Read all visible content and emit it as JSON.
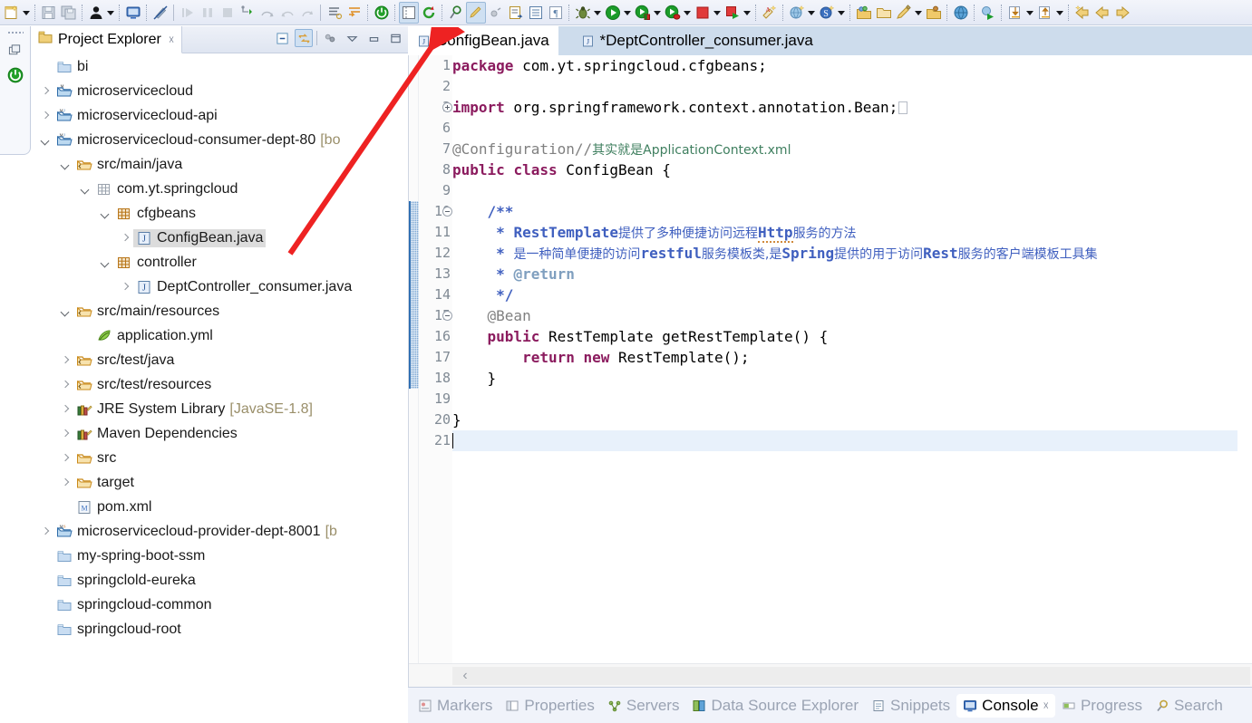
{
  "window": {
    "app": "Eclipse IDE"
  },
  "toolbar": {
    "items": [
      {
        "name": "new-wizard-icon",
        "label": "New"
      },
      {
        "name": "new-dropdown-arrow",
        "label": "New menu"
      },
      {
        "name": "save-icon",
        "label": "Save"
      },
      {
        "name": "save-all-icon",
        "label": "Save All"
      },
      {
        "name": "person-icon",
        "label": "Open Task"
      },
      {
        "name": "person-dropdown-arrow",
        "label": "Task menu"
      },
      {
        "name": "monitor-icon",
        "label": "Open Console"
      },
      {
        "name": "no-hover-icon",
        "label": "Disable hover"
      },
      {
        "name": "step-run-icon",
        "label": "Resume"
      },
      {
        "name": "pause-icon",
        "label": "Suspend"
      },
      {
        "name": "stop-icon",
        "label": "Terminate"
      },
      {
        "name": "step-into-icon",
        "label": "Step Into"
      },
      {
        "name": "step-over-icon",
        "label": "Step Over"
      },
      {
        "name": "step-return-icon",
        "label": "Step Return"
      },
      {
        "name": "drop-to-frame-icon",
        "label": "Drop to Frame"
      },
      {
        "name": "skip-breakpoints-icon",
        "label": "Skip All Breakpoints"
      },
      {
        "name": "hierarchy-icon",
        "label": "Open Type Hierarchy"
      },
      {
        "name": "power-icon",
        "label": "Server Power"
      },
      {
        "name": "toggle-block-selection-icon",
        "label": "Toggle Block Selection"
      },
      {
        "name": "refresh-icon",
        "label": "Refresh"
      },
      {
        "name": "search-pin-icon",
        "label": "Search"
      },
      {
        "name": "edit-pencil-icon",
        "label": "Edit"
      },
      {
        "name": "gear-small-icon",
        "label": "External Tools"
      },
      {
        "name": "next-annotation-icon",
        "label": "Next Annotation"
      },
      {
        "name": "outline-icon",
        "label": "Outline"
      },
      {
        "name": "pilcrow-icon",
        "label": "Show Whitespace"
      },
      {
        "name": "debug-icon",
        "label": "Debug"
      },
      {
        "name": "debug-dropdown-arrow",
        "label": "Debug menu"
      },
      {
        "name": "run-icon",
        "label": "Run"
      },
      {
        "name": "run-dropdown-arrow",
        "label": "Run menu"
      },
      {
        "name": "run-server-icon",
        "label": "Run on Server"
      },
      {
        "name": "run-server-dropdown-arrow",
        "label": "Run on Server menu"
      },
      {
        "name": "profile-icon",
        "label": "Profile"
      },
      {
        "name": "profile-dropdown-arrow",
        "label": "Profile menu"
      },
      {
        "name": "stop-red-icon",
        "label": "Stop"
      },
      {
        "name": "stop-dropdown-arrow",
        "label": "Stop menu"
      },
      {
        "name": "run-external-icon",
        "label": "External Tools"
      },
      {
        "name": "run-external-dropdown-arrow",
        "label": "External Tools menu"
      },
      {
        "name": "new-annotation-icon",
        "label": "New Annotation"
      },
      {
        "name": "new-package-icon",
        "label": "New Java Package"
      },
      {
        "name": "new-package-dropdown-arrow",
        "label": "New Package menu"
      },
      {
        "name": "new-snippet-icon",
        "label": "New Snippet"
      },
      {
        "name": "new-snippet-dropdown-arrow",
        "label": "New Snippet menu"
      },
      {
        "name": "open-type-icon",
        "label": "Open Type"
      },
      {
        "name": "open-folder-icon",
        "label": "Open Resource"
      },
      {
        "name": "open-task-icon",
        "label": "Open Task"
      },
      {
        "name": "open-task-dropdown-arrow",
        "label": "Open Task menu"
      },
      {
        "name": "open-package-icon",
        "label": "Open Package"
      },
      {
        "name": "web-browser-icon",
        "label": "Open Web Browser"
      },
      {
        "name": "deploy-icon",
        "label": "Deploy"
      },
      {
        "name": "import-icon",
        "label": "Import"
      },
      {
        "name": "import-dropdown-arrow",
        "label": "Import menu"
      },
      {
        "name": "export-icon",
        "label": "Export"
      },
      {
        "name": "export-dropdown-arrow",
        "label": "Export menu"
      },
      {
        "name": "back-star-icon",
        "label": "Back"
      },
      {
        "name": "back-icon",
        "label": "Previous"
      },
      {
        "name": "forward-icon",
        "label": "Next"
      }
    ]
  },
  "left_edge": {
    "restore_label": "Restore",
    "power_label": "Server status"
  },
  "project_explorer": {
    "title": "Project Explorer",
    "close_glyph": "☓",
    "tools": [
      {
        "name": "collapse-all-icon",
        "label": "Collapse All",
        "active": false
      },
      {
        "name": "link-with-editor-icon",
        "label": "Link with Editor",
        "active": true
      },
      {
        "name": "view-menu-filter-icon",
        "label": "Filters",
        "active": false
      },
      {
        "name": "view-menu-icon",
        "label": "View Menu",
        "active": false
      },
      {
        "name": "minimize-icon",
        "label": "Minimize",
        "active": false
      },
      {
        "name": "maximize-icon",
        "label": "Maximize",
        "active": false
      }
    ],
    "tree": [
      {
        "label": "bi",
        "sub": "",
        "indent": 0,
        "twisty": "none",
        "icon": "folder-closed",
        "selected": false
      },
      {
        "label": "microservicecloud",
        "sub": "",
        "indent": 0,
        "twisty": "right",
        "icon": "project-maven",
        "selected": false
      },
      {
        "label": "microservicecloud-api",
        "sub": "",
        "indent": 0,
        "twisty": "right",
        "icon": "project-maven-java",
        "selected": false
      },
      {
        "label": "microservicecloud-consumer-dept-80",
        "sub": "[bo",
        "indent": 0,
        "twisty": "down",
        "icon": "project-maven-java",
        "selected": false
      },
      {
        "label": "src/main/java",
        "sub": "",
        "indent": 1,
        "twisty": "down",
        "icon": "source-folder",
        "selected": false
      },
      {
        "label": "com.yt.springcloud",
        "sub": "",
        "indent": 2,
        "twisty": "down",
        "icon": "package-empty",
        "selected": false
      },
      {
        "label": "cfgbeans",
        "sub": "",
        "indent": 3,
        "twisty": "down",
        "icon": "package",
        "selected": false
      },
      {
        "label": "ConfigBean.java",
        "sub": "",
        "indent": 4,
        "twisty": "right",
        "icon": "java-file",
        "selected": true
      },
      {
        "label": "controller",
        "sub": "",
        "indent": 3,
        "twisty": "down",
        "icon": "package",
        "selected": false
      },
      {
        "label": "DeptController_consumer.java",
        "sub": "",
        "indent": 4,
        "twisty": "right",
        "icon": "java-file",
        "selected": false
      },
      {
        "label": "src/main/resources",
        "sub": "",
        "indent": 1,
        "twisty": "down",
        "icon": "source-folder",
        "selected": false
      },
      {
        "label": "application.yml",
        "sub": "",
        "indent": 2,
        "twisty": "none",
        "icon": "yml-file",
        "selected": false
      },
      {
        "label": "src/test/java",
        "sub": "",
        "indent": 1,
        "twisty": "right",
        "icon": "source-folder",
        "selected": false
      },
      {
        "label": "src/test/resources",
        "sub": "",
        "indent": 1,
        "twisty": "right",
        "icon": "source-folder",
        "selected": false
      },
      {
        "label": "JRE System Library",
        "sub": "[JavaSE-1.8]",
        "indent": 1,
        "twisty": "right",
        "icon": "library",
        "selected": false
      },
      {
        "label": "Maven Dependencies",
        "sub": "",
        "indent": 1,
        "twisty": "right",
        "icon": "library",
        "selected": false
      },
      {
        "label": "src",
        "sub": "",
        "indent": 1,
        "twisty": "right",
        "icon": "folder-open",
        "selected": false
      },
      {
        "label": "target",
        "sub": "",
        "indent": 1,
        "twisty": "right",
        "icon": "folder-open",
        "selected": false
      },
      {
        "label": "pom.xml",
        "sub": "",
        "indent": 1,
        "twisty": "none",
        "icon": "pom-file",
        "selected": false
      },
      {
        "label": "microservicecloud-provider-dept-8001",
        "sub": "[b",
        "indent": 0,
        "twisty": "right",
        "icon": "project-maven-spring",
        "selected": false
      },
      {
        "label": "my-spring-boot-ssm",
        "sub": "",
        "indent": 0,
        "twisty": "none",
        "icon": "folder-closed",
        "selected": false
      },
      {
        "label": "springclold-eureka",
        "sub": "",
        "indent": 0,
        "twisty": "none",
        "icon": "folder-closed",
        "selected": false
      },
      {
        "label": "springcloud-common",
        "sub": "",
        "indent": 0,
        "twisty": "none",
        "icon": "folder-closed",
        "selected": false
      },
      {
        "label": "springcloud-root",
        "sub": "",
        "indent": 0,
        "twisty": "none",
        "icon": "folder-closed",
        "selected": false
      }
    ]
  },
  "editor": {
    "tabs": [
      {
        "label": "ConfigBean.java",
        "active": true,
        "dirty": false,
        "close_glyph": "☓"
      },
      {
        "label": "*DeptController_consumer.java",
        "active": false,
        "dirty": true,
        "close_glyph": ""
      }
    ],
    "lines": [
      {
        "n": "1",
        "fold": "none"
      },
      {
        "n": "2",
        "fold": "none"
      },
      {
        "n": "3",
        "fold": "plus"
      },
      {
        "n": "6",
        "fold": "none"
      },
      {
        "n": "7",
        "fold": "none"
      },
      {
        "n": "8",
        "fold": "none"
      },
      {
        "n": "9",
        "fold": "none"
      },
      {
        "n": "10",
        "fold": "minus"
      },
      {
        "n": "11",
        "fold": "none"
      },
      {
        "n": "12",
        "fold": "none"
      },
      {
        "n": "13",
        "fold": "none"
      },
      {
        "n": "14",
        "fold": "none"
      },
      {
        "n": "15",
        "fold": "minus"
      },
      {
        "n": "16",
        "fold": "none"
      },
      {
        "n": "17",
        "fold": "none"
      },
      {
        "n": "18",
        "fold": "none"
      },
      {
        "n": "19",
        "fold": "none"
      },
      {
        "n": "20",
        "fold": "none"
      },
      {
        "n": "21",
        "fold": "none"
      }
    ],
    "code": {
      "l1_kw": "package",
      "l1_rest": " com.yt.springcloud.cfgbeans;",
      "l3_kw": "import",
      "l3_rest": " org.springframework.context.annotation.Bean;",
      "l7_ann": "@Configuration//",
      "l7_cmt": "其实就是ApplicationContext.xml",
      "l8_kw1": "public",
      "l8_kw2": "class",
      "l8_name": " ConfigBean {",
      "l10": "    /**",
      "l11_star": "     * ",
      "l11_en": "RestTemplate",
      "l11_cn1": "提供了多种便捷访问远程",
      "l11_en2": "Http",
      "l11_cn2": "服务的方法",
      "l12_star": "     * ",
      "l12_cn1": "是一种简单便捷的访问",
      "l12_en1": "restful",
      "l12_cn2": "服务模板类,是",
      "l12_en2": "Spring",
      "l12_cn3": "提供的用于访问",
      "l12_en3": "Rest",
      "l12_cn4": "服务的客户端模板工具集",
      "l13_star": "     * ",
      "l13_tag": "@return",
      "l14": "     */",
      "l15": "    @Bean",
      "l16_kw": "    public",
      "l16_rest": " RestTemplate getRestTemplate() {",
      "l17_kw1": "        return",
      "l17_kw2": " new",
      "l17_rest": " RestTemplate();",
      "l18": "    }",
      "l19": "",
      "l20": "}",
      "l21": ""
    },
    "hscroll_left_arrow": "‹"
  },
  "bottom_views": [
    {
      "label": "Markers",
      "icon": "markers-icon",
      "active": false,
      "close": ""
    },
    {
      "label": "Properties",
      "icon": "properties-icon",
      "active": false,
      "close": ""
    },
    {
      "label": "Servers",
      "icon": "servers-icon",
      "active": false,
      "close": ""
    },
    {
      "label": "Data Source Explorer",
      "icon": "data-source-icon",
      "active": false,
      "close": ""
    },
    {
      "label": "Snippets",
      "icon": "snippets-icon",
      "active": false,
      "close": ""
    },
    {
      "label": "Console",
      "icon": "console-icon",
      "active": true,
      "close": "☓"
    },
    {
      "label": "Progress",
      "icon": "progress-icon",
      "active": false,
      "close": ""
    },
    {
      "label": "Search",
      "icon": "search-icon",
      "active": false,
      "close": ""
    }
  ],
  "annotation": {
    "arrow_color": "#ee2222",
    "arrow_target": "ConfigBean.java editor tab"
  },
  "colors": {
    "keyword": "#8b1b5e",
    "javadoc": "#3f5fbf",
    "comment": "#3f7f5f",
    "annotation": "#808080",
    "tab_active_bg": "#ffffff",
    "tab_strip_bg": "#cddcec",
    "selection_bg": "#dcdcdc",
    "current_line_bg": "#e8f1fb",
    "marker_bar": "#7fa9d4"
  }
}
